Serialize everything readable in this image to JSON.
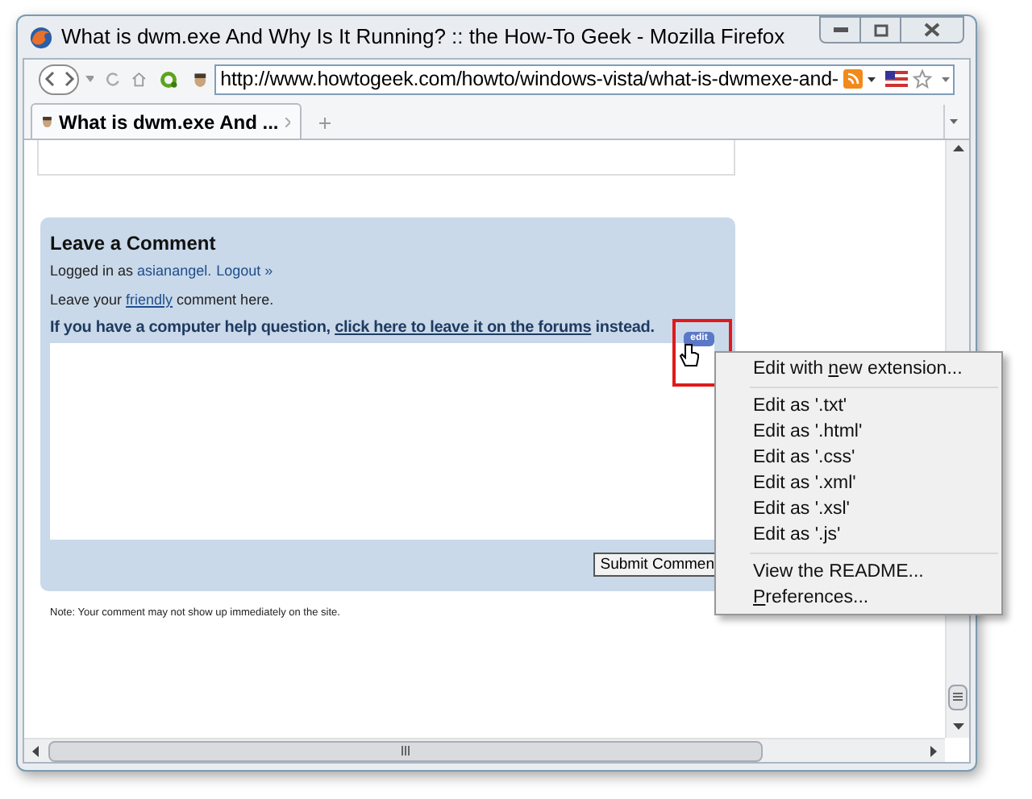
{
  "window": {
    "title": "What is dwm.exe And Why Is It Running? :: the How-To Geek - Mozilla Firefox"
  },
  "address_bar": {
    "value": "http://www.howtogeek.com/howto/windows-vista/what-is-dwmexe-and-"
  },
  "tabs": [
    {
      "label": "What is dwm.exe And ...",
      "selected": true
    }
  ],
  "comment_form": {
    "heading": "Leave a Comment",
    "logged_in": [
      {
        "kind": "text",
        "text": "Logged in as "
      },
      {
        "kind": "link",
        "text": "asianangel."
      },
      {
        "kind": "link",
        "text": "Logout »"
      }
    ],
    "prompt": [
      {
        "kind": "text",
        "text": "Leave your "
      },
      {
        "kind": "link",
        "text": "friendly"
      },
      {
        "kind": "text",
        "text": " comment here."
      }
    ],
    "help": [
      {
        "kind": "text",
        "text": "If you have a computer help question, "
      },
      {
        "kind": "link",
        "text": "click here to leave it on the forums"
      },
      {
        "kind": "text",
        "text": " instead."
      }
    ],
    "submit": "Submit Commen",
    "note": "Note: Your comment may not show up immediately on the site."
  },
  "edit_button": {
    "label": "edit"
  },
  "context_menu": [
    {
      "kind": "item",
      "before": "Edit with ",
      "key": "n",
      "after": "ew extension..."
    },
    {
      "kind": "separator"
    },
    {
      "kind": "item",
      "before": "Edit as '.txt'"
    },
    {
      "kind": "item",
      "before": "Edit as '.html'"
    },
    {
      "kind": "item",
      "before": "Edit as '.css'"
    },
    {
      "kind": "item",
      "before": "Edit as '.xml'"
    },
    {
      "kind": "item",
      "before": "Edit as '.xsl'"
    },
    {
      "kind": "item",
      "before": "Edit as '.js'"
    },
    {
      "kind": "separator"
    },
    {
      "kind": "item",
      "before": "View the README..."
    },
    {
      "kind": "item",
      "key": "P",
      "after": "references..."
    }
  ]
}
